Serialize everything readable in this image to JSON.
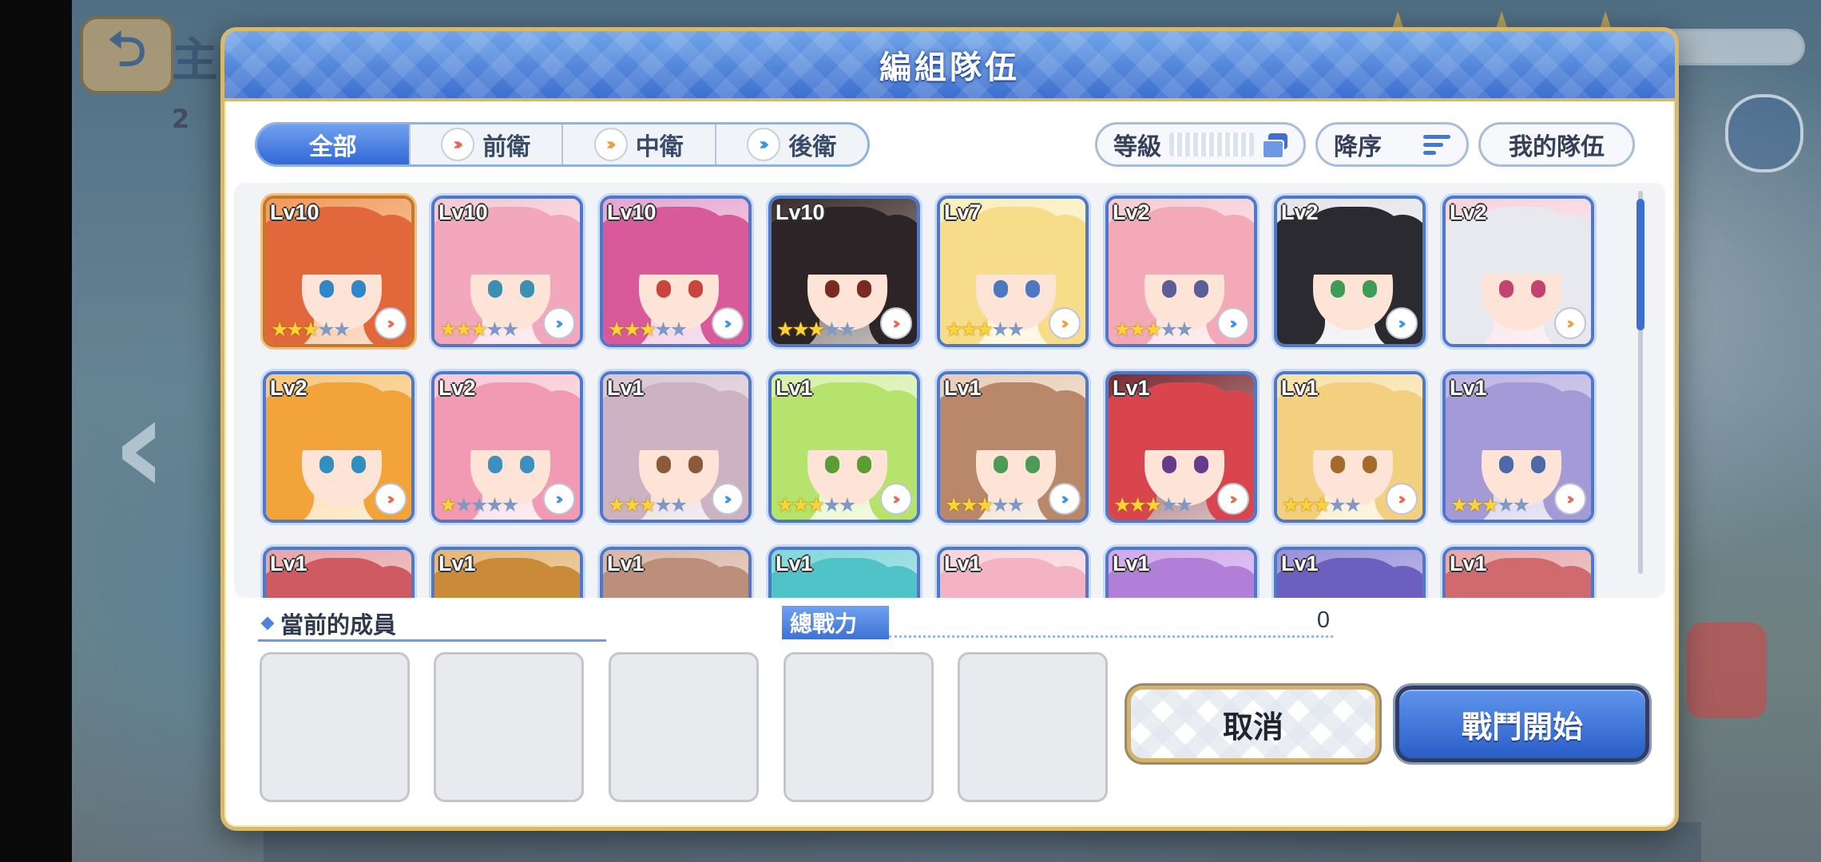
{
  "dialog": {
    "title": "編組隊伍"
  },
  "filters": {
    "tabs": [
      {
        "label": "全部",
        "icon": ""
      },
      {
        "label": "前衛",
        "icon": "front-chevron-icon"
      },
      {
        "label": "中衛",
        "icon": "mid-chevron-icon"
      },
      {
        "label": "後衛",
        "icon": "back-chevron-icon"
      }
    ],
    "sort_label": "等級",
    "order_label": "降序",
    "my_team_label": "我的隊伍"
  },
  "characters": [
    {
      "level": "Lv10",
      "stars": 3,
      "role": "front",
      "hair": "#e2673a",
      "eyes": "#2f86c8",
      "bg": "#f09a5a",
      "rainbow": true
    },
    {
      "level": "Lv10",
      "stars": 3,
      "role": "back",
      "hair": "#f3a7bd",
      "eyes": "#3b8fb3",
      "bg": "#f4c9d5"
    },
    {
      "level": "Lv10",
      "stars": 3,
      "role": "back",
      "hair": "#d95a9a",
      "eyes": "#c8443e",
      "bg": "#e6a6d0"
    },
    {
      "level": "Lv10",
      "stars": 3,
      "role": "front",
      "hair": "#2c2426",
      "eyes": "#7a2a20",
      "bg": "#3a2b2a"
    },
    {
      "level": "Lv7",
      "stars": 3,
      "role": "mid",
      "hair": "#f7dc8a",
      "eyes": "#4d78c0",
      "bg": "#fbeebb"
    },
    {
      "level": "Lv2",
      "stars": 3,
      "role": "back",
      "hair": "#f4a9b8",
      "eyes": "#5c5e99",
      "bg": "#f6cbd4"
    },
    {
      "level": "Lv2",
      "stars": 0,
      "role": "back",
      "hair": "#2a2a30",
      "eyes": "#3e9d55",
      "bg": "#e4e4ea"
    },
    {
      "level": "Lv2",
      "stars": 0,
      "role": "mid",
      "hair": "#e8e8ef",
      "eyes": "#c2446e",
      "bg": "#f6d4dc"
    },
    {
      "level": "Lv2",
      "stars": 0,
      "role": "front",
      "hair": "#f2a33a",
      "eyes": "#2f8fc0",
      "bg": "#f7c77b"
    },
    {
      "level": "Lv2",
      "stars": 1,
      "role": "back",
      "hair": "#f29ab4",
      "eyes": "#3c8fc0",
      "bg": "#f9c7d6"
    },
    {
      "level": "Lv1",
      "stars": 3,
      "role": "back",
      "hair": "#cdb2c4",
      "eyes": "#8a5a3a",
      "bg": "#d9c6d2"
    },
    {
      "level": "Lv1",
      "stars": 3,
      "role": "front",
      "hair": "#b6e36b",
      "eyes": "#5a9e33",
      "bg": "#d6f0a8"
    },
    {
      "level": "Lv1",
      "stars": 3,
      "role": "back",
      "hair": "#b9876a",
      "eyes": "#4d9a55",
      "bg": "#e8cdb6"
    },
    {
      "level": "Lv1",
      "stars": 3,
      "role": "front",
      "hair": "#d9454d",
      "eyes": "#6a3a8a",
      "bg": "#7a2c32"
    },
    {
      "level": "Lv1",
      "stars": 3,
      "role": "front",
      "hair": "#f2d080",
      "eyes": "#a36a2a",
      "bg": "#f8e1a8"
    },
    {
      "level": "Lv1",
      "stars": 3,
      "role": "front",
      "hair": "#a59ad8",
      "eyes": "#4d6aa8",
      "bg": "#bcb3e3"
    },
    {
      "level": "Lv1",
      "stars": 0,
      "role": "back",
      "hair": "#cf5a62",
      "eyes": "#444",
      "bg": "#e7a3a7"
    },
    {
      "level": "Lv1",
      "stars": 0,
      "role": "back",
      "hair": "#c98a3a",
      "eyes": "#444",
      "bg": "#e4b675"
    },
    {
      "level": "Lv1",
      "stars": 0,
      "role": "back",
      "hair": "#bb8f7a",
      "eyes": "#444",
      "bg": "#d8b6a5"
    },
    {
      "level": "Lv1",
      "stars": 0,
      "role": "back",
      "hair": "#4fc3c7",
      "eyes": "#444",
      "bg": "#7fd7d9"
    },
    {
      "level": "Lv1",
      "stars": 0,
      "role": "back",
      "hair": "#f4b3c3",
      "eyes": "#444",
      "bg": "#f8d3dc"
    },
    {
      "level": "Lv1",
      "stars": 0,
      "role": "back",
      "hair": "#b17ed8",
      "eyes": "#444",
      "bg": "#cfa8ea"
    },
    {
      "level": "Lv1",
      "stars": 0,
      "role": "back",
      "hair": "#6c5fc0",
      "eyes": "#444",
      "bg": "#9a90d8"
    },
    {
      "level": "Lv1",
      "stars": 0,
      "role": "back",
      "hair": "#d06a6e",
      "eyes": "#444",
      "bg": "#e7a8a9"
    }
  ],
  "team": {
    "section_title": "當前的成員",
    "power_label": "總戰力",
    "power_value": "0",
    "slots": 5
  },
  "buttons": {
    "cancel": "取消",
    "start": "戰鬥開始"
  },
  "background": {
    "title": "主",
    "subtitle": "2"
  }
}
